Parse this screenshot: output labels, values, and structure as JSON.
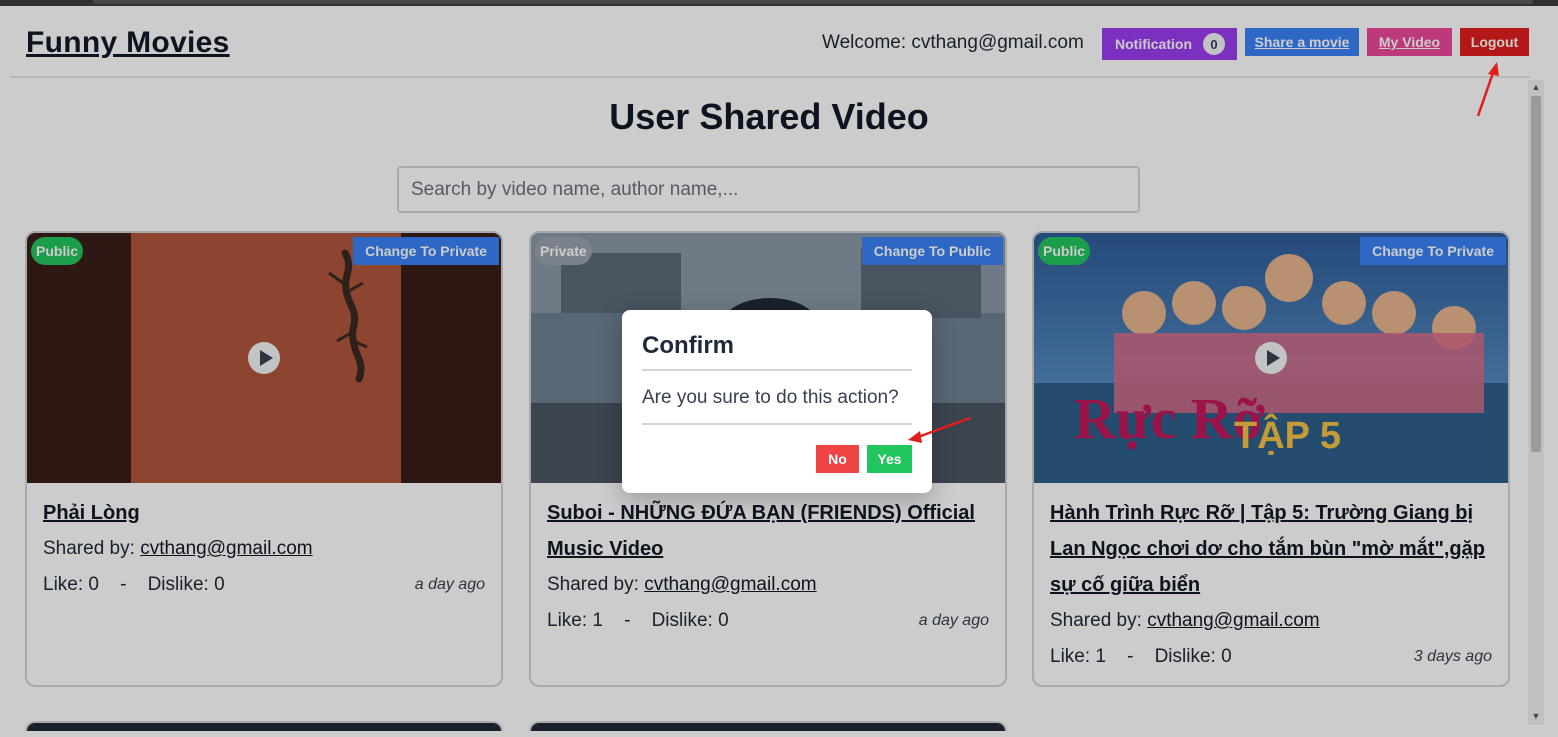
{
  "header": {
    "brand": "Funny Movies",
    "welcome": "Welcome: cvthang@gmail.com",
    "notification_label": "Notification",
    "notification_count": "0",
    "share_label": "Share a movie",
    "my_video_label": "My Video",
    "logout_label": "Logout"
  },
  "main": {
    "title": "User Shared Video",
    "search_placeholder": "Search by video name, author name,..."
  },
  "labels": {
    "shared_by": "Shared by:",
    "like": "Like:",
    "dislike": "Dislike:",
    "dash": "-"
  },
  "videos": [
    {
      "status": "Public",
      "toggle_label": "Change To Private",
      "title": "Phải Lòng",
      "author": "cvthang@gmail.com",
      "likes": "0",
      "dislikes": "0",
      "time_ago": "a day ago"
    },
    {
      "status": "Private",
      "toggle_label": "Change To Public",
      "title": "Suboi - NHỮNG ĐỨA BẠN (FRIENDS) Official Music Video",
      "author": "cvthang@gmail.com",
      "likes": "1",
      "dislikes": "0",
      "time_ago": "a day ago"
    },
    {
      "status": "Public",
      "toggle_label": "Change To Private",
      "title": "Hành Trình Rực Rỡ | Tập 5: Trường Giang bị Lan Ngọc chơi dơ cho tắm bùn \"mờ mắt\",gặp sự cố giữa biển",
      "author": "cvthang@gmail.com",
      "likes": "1",
      "dislikes": "0",
      "time_ago": "3 days ago"
    }
  ],
  "dialog": {
    "title": "Confirm",
    "message": "Are you sure to do this action?",
    "no_label": "No",
    "yes_label": "Yes"
  },
  "colors": {
    "notification": "#9b3cf0",
    "share": "#3b82f6",
    "my_video": "#ec4899",
    "logout": "#e11d1d",
    "public_badge": "#22c55e",
    "private_badge": "#9ca3af",
    "no_button": "#ef4444",
    "yes_button": "#22c55e",
    "annotation_arrow": "#e11d1d"
  }
}
